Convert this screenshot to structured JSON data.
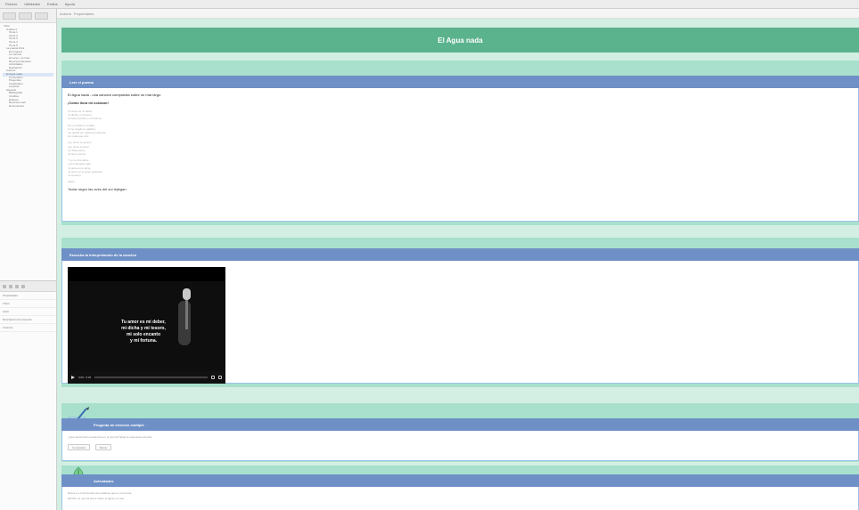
{
  "menubar": {
    "items": [
      "Fichero",
      "Utilidades",
      "Estilos",
      "Ayuda"
    ]
  },
  "tree": {
    "items": [
      {
        "label": "Inicio",
        "selected": false
      },
      {
        "label": "Unidad 1",
        "selected": false
      },
      {
        "label": "Tema 1",
        "selected": false
      },
      {
        "label": "Tema 2",
        "selected": false
      },
      {
        "label": "Tema 3",
        "selected": false
      },
      {
        "label": "Tema 4",
        "selected": false
      },
      {
        "label": "Tema 5",
        "selected": false
      },
      {
        "label": "La poesía lírica",
        "selected": false
      },
      {
        "label": "El romance",
        "selected": false
      },
      {
        "label": "La métrica",
        "selected": false
      },
      {
        "label": "El verso y la rima",
        "selected": false
      },
      {
        "label": "Recursos literarios",
        "selected": false
      },
      {
        "label": "Actividades",
        "selected": false
      },
      {
        "label": "Evaluación",
        "selected": false
      },
      {
        "label": "Autores",
        "selected": false
      },
      {
        "label": "El Agua nada",
        "selected": true
      },
      {
        "label": "Comentario",
        "selected": false
      },
      {
        "label": "Preguntas",
        "selected": false
      },
      {
        "label": "Vocabulario",
        "selected": false
      },
      {
        "label": "Lecturas",
        "selected": false
      },
      {
        "label": "Glosario",
        "selected": false
      },
      {
        "label": "Bibliografía",
        "selected": false
      },
      {
        "label": "Créditos",
        "selected": false
      },
      {
        "label": "Enlaces",
        "selected": false
      },
      {
        "label": "Recursos web",
        "selected": false
      },
      {
        "label": "Documentos",
        "selected": false
      }
    ]
  },
  "props": {
    "rows": [
      "Propiedades",
      "Título",
      "Autor",
      "Descripción del proyecto",
      "Licencia"
    ]
  },
  "editor": {
    "tabs": [
      "Autoría",
      "Propiedades"
    ]
  },
  "page": {
    "title": "El Agua nada",
    "block1": {
      "heading": "Leer el poema",
      "intro": "El Agua nada - una canción compuesta sobre un mar largo",
      "subhead": "¡Cómo llora mi corazón!",
      "stanzas": [
        [
          "Tu amor es mi deber,",
          "mi dicha y mi tesoro,",
          "mi solo encanto y mi fortuna."
        ],
        [
          "Si me quitas tu mirada,",
          "si me niegas tu palabra,",
          "me quedo sin nada que esperar,",
          "sin nada que vivir."
        ],
        [
          "¡Ay, cómo te quiero!",
          "¡Ay, cómo te lloro!",
          "mi vida entera,",
          "mi amor eterno."
        ],
        [
          "Y yo te di el alma,",
          "y tú te llevaste todo,",
          "mi alma en tu alma,",
          "mi amor en tu amor profundo,",
          "mi corazón."
        ],
        [
          "Adiós."
        ]
      ],
      "ending": "Todas negro las aves del sol tejiegan."
    },
    "block2": {
      "heading": "Escucha la interpretación de la canción",
      "caption": [
        "Tu amor es mi deber,",
        "mi dicha y mi tesoro,",
        "mi solo encanto",
        "y mi fortuna."
      ],
      "time": "0:00 / 3:25",
      "progress": 0.0
    },
    "gap_label": "...",
    "block3": {
      "heading": "Pregunta de elección múltiple",
      "question": "¿Qué sentimiento predomina en el poema? Elige la respuesta correcta.",
      "buttons": [
        "Comprobar",
        "Borrar"
      ]
    },
    "block4": {
      "heading": "Actividades",
      "lines": [
        "Busca en el diccionario las palabras que no conozcas.",
        "Escribe un poema breve sobre el agua y el mar."
      ]
    }
  },
  "colors": {
    "banner": "#5bb38e",
    "section_bg": "#a8e0cd",
    "idevice_head": "#6e90c6"
  }
}
